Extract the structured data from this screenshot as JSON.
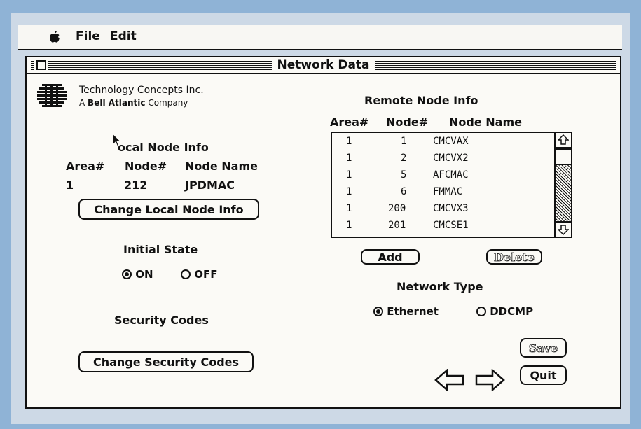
{
  "menubar": {
    "file_label": "File",
    "edit_label": "Edit"
  },
  "window": {
    "title": "Network Data"
  },
  "company": {
    "name": "Technology Concepts Inc.",
    "tagline_prefix": "A",
    "tagline_brand": "Bell Atlantic",
    "tagline_suffix": "Company"
  },
  "local": {
    "heading": "ocal Node Info",
    "headers": [
      "Area#",
      "Node#",
      "Node Name"
    ],
    "area": "1",
    "node": "212",
    "name": "JPDMAC",
    "change_button": "Change Local Node Info"
  },
  "initial_state": {
    "heading": "Initial State",
    "on_label": "ON",
    "off_label": "OFF",
    "selected": "ON"
  },
  "security": {
    "heading": "Security Codes",
    "change_button": "Change Security Codes"
  },
  "remote": {
    "heading": "Remote Node Info",
    "headers": [
      "Area#",
      "Node#",
      "Node Name"
    ],
    "rows": [
      {
        "area": "1",
        "node": "1",
        "name": "CMCVAX"
      },
      {
        "area": "1",
        "node": "2",
        "name": "CMCVX2"
      },
      {
        "area": "1",
        "node": "5",
        "name": "AFCMAC"
      },
      {
        "area": "1",
        "node": "6",
        "name": "FMMAC"
      },
      {
        "area": "1",
        "node": "200",
        "name": "CMCVX3"
      },
      {
        "area": "1",
        "node": "201",
        "name": "CMCSE1"
      }
    ],
    "add_button": "Add",
    "delete_button": "Delete"
  },
  "network_type": {
    "heading": "Network Type",
    "ethernet_label": "Ethernet",
    "ddcmp_label": "DDCMP",
    "selected": "Ethernet"
  },
  "actions": {
    "save_button": "Save",
    "quit_button": "Quit"
  }
}
